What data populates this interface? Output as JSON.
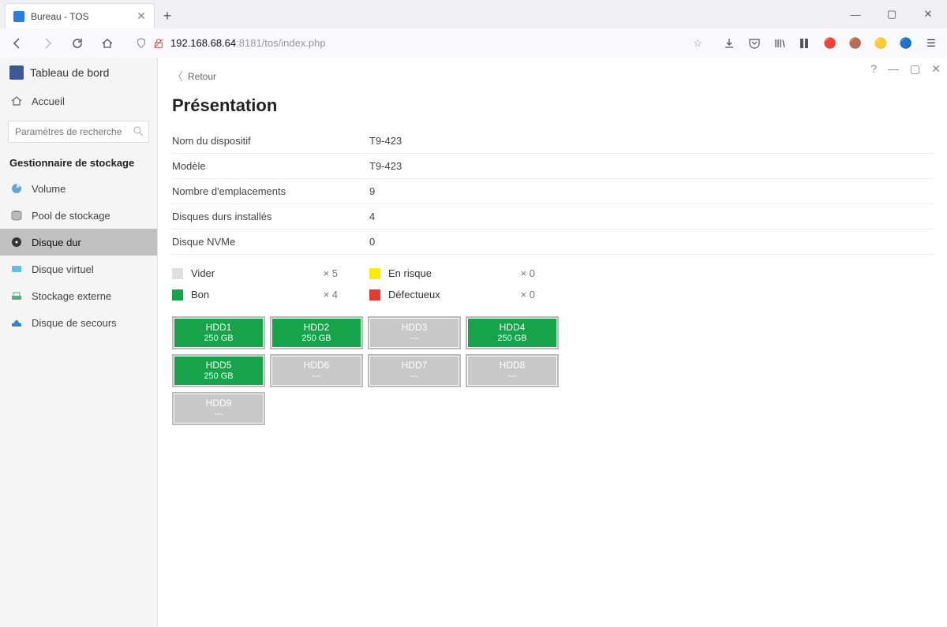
{
  "browser": {
    "tab_title": "Bureau - TOS",
    "url_host": "192.168.68.64",
    "url_path": ":8181/tos/index.php"
  },
  "sidebar": {
    "app_title": "Tableau de bord",
    "accueil": "Accueil",
    "search_placeholder": "Paramètres de recherche",
    "section_title": "Gestionnaire de stockage",
    "items": [
      {
        "label": "Volume"
      },
      {
        "label": "Pool de stockage"
      },
      {
        "label": "Disque dur"
      },
      {
        "label": "Disque virtuel"
      },
      {
        "label": "Stockage externe"
      },
      {
        "label": "Disque de secours"
      }
    ]
  },
  "content": {
    "retour": "Retour",
    "title": "Présentation",
    "info": [
      {
        "label": "Nom du dispositif",
        "value": "T9-423"
      },
      {
        "label": "Modèle",
        "value": "T9-423"
      },
      {
        "label": "Nombre d'emplacements",
        "value": "9"
      },
      {
        "label": "Disques durs installés",
        "value": "4"
      },
      {
        "label": "Disque NVMe",
        "value": "0"
      }
    ],
    "legend": {
      "vider": {
        "label": "Vider",
        "count": "× 5"
      },
      "bon": {
        "label": "Bon",
        "count": "× 4"
      },
      "risque": {
        "label": "En risque",
        "count": "× 0"
      },
      "defect": {
        "label": "Défectueux",
        "count": "× 0"
      }
    },
    "drives": [
      {
        "name": "HDD1",
        "size": "250 GB",
        "status": "good"
      },
      {
        "name": "HDD2",
        "size": "250 GB",
        "status": "good"
      },
      {
        "name": "HDD3",
        "size": "---",
        "status": "empty"
      },
      {
        "name": "HDD4",
        "size": "250 GB",
        "status": "good"
      },
      {
        "name": "HDD5",
        "size": "250 GB",
        "status": "good"
      },
      {
        "name": "HDD6",
        "size": "---",
        "status": "empty"
      },
      {
        "name": "HDD7",
        "size": "---",
        "status": "empty"
      },
      {
        "name": "HDD8",
        "size": "---",
        "status": "empty"
      },
      {
        "name": "HDD9",
        "size": "---",
        "status": "empty"
      }
    ]
  }
}
